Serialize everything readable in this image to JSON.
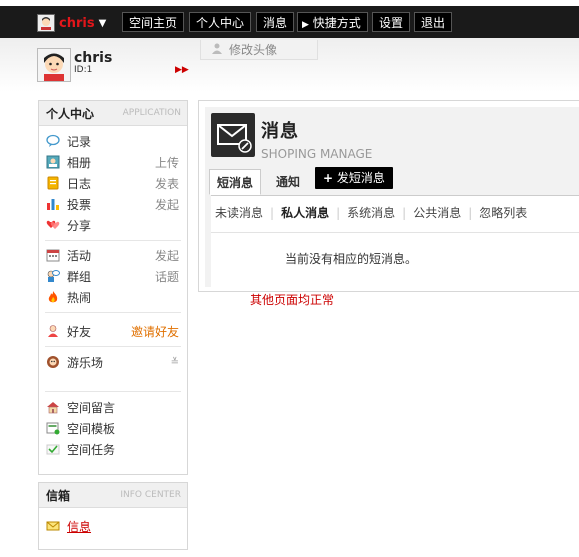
{
  "topbar": {
    "username": "chris",
    "nav": [
      "空间主页",
      "个人中心",
      "消息",
      "快捷方式",
      "设置",
      "退出"
    ]
  },
  "profile": {
    "name": "chris",
    "id_text": "ID:1",
    "change_avatar": "修改头像"
  },
  "sidebar": {
    "title": "个人中心",
    "title_en": "APPLICATION",
    "items": [
      {
        "label": "记录",
        "extra": "",
        "icon": "speech-bubble-icon"
      },
      {
        "label": "相册",
        "extra": "上传",
        "icon": "photo-album-icon"
      },
      {
        "label": "日志",
        "extra": "发表",
        "icon": "blog-icon"
      },
      {
        "label": "投票",
        "extra": "发起",
        "icon": "poll-icon"
      },
      {
        "label": "分享",
        "extra": "",
        "icon": "share-hearts-icon"
      },
      {
        "label": "活动",
        "extra": "发起",
        "icon": "calendar-icon"
      },
      {
        "label": "群组",
        "extra": "话题",
        "icon": "group-icon"
      },
      {
        "label": "热闹",
        "extra": "",
        "icon": "fire-icon"
      },
      {
        "label": "好友",
        "extra": "邀请好友",
        "icon": "friend-icon"
      },
      {
        "label": "游乐场",
        "extra": "",
        "icon": "playground-icon"
      },
      {
        "label": "空间留言",
        "extra": "",
        "icon": "guestbook-icon"
      },
      {
        "label": "空间模板",
        "extra": "",
        "icon": "template-icon"
      },
      {
        "label": "空间任务",
        "extra": "",
        "icon": "task-icon"
      }
    ]
  },
  "inbox": {
    "title": "信箱",
    "title_en": "INFO CENTER",
    "item": "信息"
  },
  "main": {
    "title": "消息",
    "subtitle": "SHOPING MANAGE",
    "tabs": [
      "短消息",
      "通知"
    ],
    "send_button": "发短消息",
    "sub_tabs": [
      "未读消息",
      "私人消息",
      "系统消息",
      "公共消息",
      "忽略列表"
    ],
    "empty_text": "当前没有相应的短消息。"
  },
  "note": "其他页面均正常",
  "colors": {
    "accent_red": "#cc0000",
    "topbar": "#1a1a1a",
    "orange_link": "#e07000"
  }
}
